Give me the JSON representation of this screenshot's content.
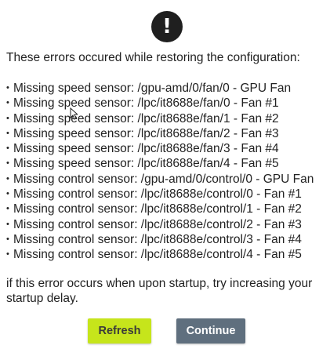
{
  "dialog": {
    "icon": "exclamation-circle-icon",
    "icon_glyph": "!",
    "intro": "These errors occured while restoring the configuration:",
    "errors": [
      "Missing speed sensor: /gpu-amd/0/fan/0 - GPU Fan",
      "Missing speed sensor: /lpc/it8688e/fan/0 - Fan #1",
      "Missing speed sensor: /lpc/it8688e/fan/1 - Fan #2",
      "Missing speed sensor: /lpc/it8688e/fan/2 - Fan #3",
      "Missing speed sensor: /lpc/it8688e/fan/3 - Fan #4",
      "Missing speed sensor: /lpc/it8688e/fan/4 - Fan #5",
      "Missing control sensor: /gpu-amd/0/control/0 - GPU Fan",
      "Missing control sensor: /lpc/it8688e/control/0 - Fan #1",
      "Missing control sensor: /lpc/it8688e/control/1 - Fan #2",
      "Missing control sensor: /lpc/it8688e/control/2 - Fan #3",
      "Missing control sensor: /lpc/it8688e/control/3 - Fan #4",
      "Missing control sensor: /lpc/it8688e/control/4 - Fan #5"
    ],
    "footnote": "if this error occurs when upon startup, try increasing your startup delay.",
    "buttons": {
      "refresh_label": "Refresh",
      "continue_label": "Continue"
    }
  },
  "colors": {
    "icon_background": "#1f1f1f",
    "refresh_button": "#c6e51b",
    "continue_button": "#5f6f7e",
    "text": "#222222"
  }
}
